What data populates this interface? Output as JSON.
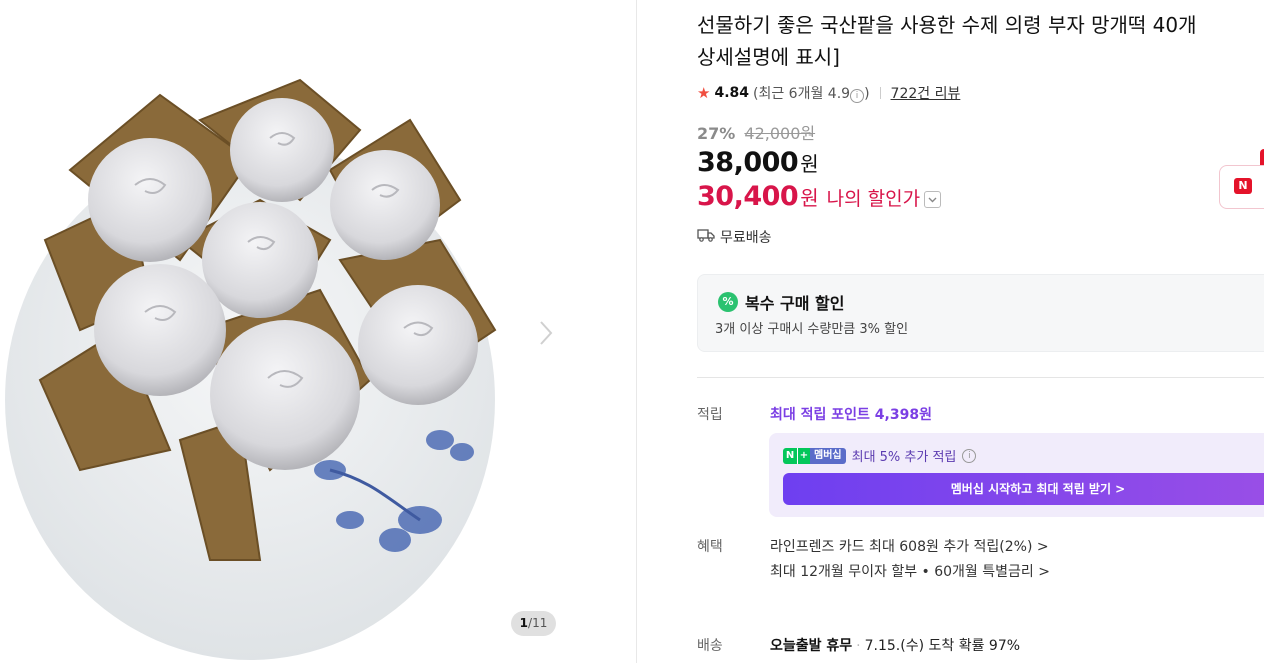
{
  "gallery": {
    "page_current": "1",
    "page_total": "11"
  },
  "product": {
    "title_line1": "선물하기 좋은 국산팥을 사용한 수제 의령 부자 망개떡 40개",
    "title_line2": "상세설명에 표시]"
  },
  "rating": {
    "score": "4.84",
    "recent": "(최근 6개월 4.9",
    "recent_close": ")",
    "reviews": "722건 리뷰"
  },
  "price": {
    "discount_rate": "27%",
    "original": "42,000원",
    "sale": "38,000",
    "won": "원",
    "my_price": "30,400",
    "my_price_label": "나의 할인가"
  },
  "shipping": {
    "label": "무료배송"
  },
  "multi_discount": {
    "icon_text": "%",
    "title": "복수 구매 할인",
    "desc": "3개 이상 구매시 수량만큼 3% 할인"
  },
  "points": {
    "label": "적립",
    "max_link": "최대 적립 포인트 4,398원",
    "badge_n": "N",
    "badge_plus": "+",
    "badge_member": "멤버십",
    "extra_text": "최대 5% 추가 적립",
    "button": "멤버십 시작하고 최대 적립 받기 >"
  },
  "benefits": {
    "label": "혜택",
    "line1": "라인프렌즈 카드 최대 608원 추가 적립(2%) >",
    "line2": "최대 12개월 무이자 할부 • 60개월 특별금리 >"
  },
  "delivery": {
    "label": "배송",
    "status": "오늘출발 휴무",
    "arrival": "7.15.(수) 도착 확률 97%"
  },
  "side": {
    "badge": "N"
  },
  "colors": {
    "accent_purple": "#7b3fe4",
    "price_red": "#d8154a",
    "green": "#2bc270"
  }
}
